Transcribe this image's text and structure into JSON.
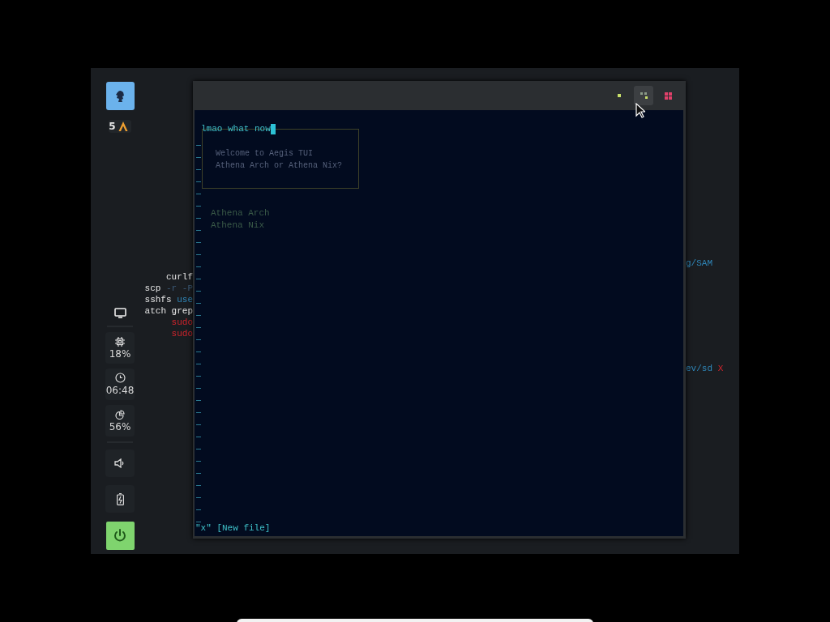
{
  "sidebar": {
    "workspace": {
      "selected": true
    },
    "workspace_count": "5",
    "stats": [
      {
        "kind": "cpu",
        "value": "18%"
      },
      {
        "kind": "clock",
        "value": "06:48"
      },
      {
        "kind": "memory",
        "value": "56%"
      }
    ]
  },
  "background_terminal": {
    "left_lines": [
      [
        {
          "kind": "command",
          "text": "curlf"
        }
      ],
      [
        {
          "kind": "command",
          "text": "scp"
        },
        {
          "kind": "arg",
          "text": "-r -P"
        }
      ],
      [
        {
          "kind": "command",
          "text": "sshfs"
        },
        {
          "kind": "path",
          "text": "use"
        }
      ],
      [
        {
          "kind": "command",
          "text": "atch grep"
        }
      ],
      [
        {
          "kind": "danger",
          "text": "sudo"
        }
      ],
      [
        {
          "kind": "danger",
          "text": "sudo"
        }
      ]
    ],
    "right_lines": [
      [
        {
          "kind": "path",
          "text": "g/SAM"
        }
      ],
      [
        {
          "kind": "path",
          "text": "ev/sd"
        },
        {
          "kind": "danger",
          "text": "X"
        }
      ]
    ]
  },
  "terminal_window": {
    "buttons": [
      {
        "kind": "minimize",
        "hovered": false
      },
      {
        "kind": "maximize",
        "hovered": true
      },
      {
        "kind": "close",
        "hovered": false
      }
    ],
    "prompt": "lmao what now",
    "dialog": [
      "Welcome to Aegis TUI",
      "Athena Arch or Athena Nix?"
    ],
    "options": [
      "Athena Arch",
      "Athena Nix"
    ],
    "status_line": "\"x\" [New file]"
  }
}
